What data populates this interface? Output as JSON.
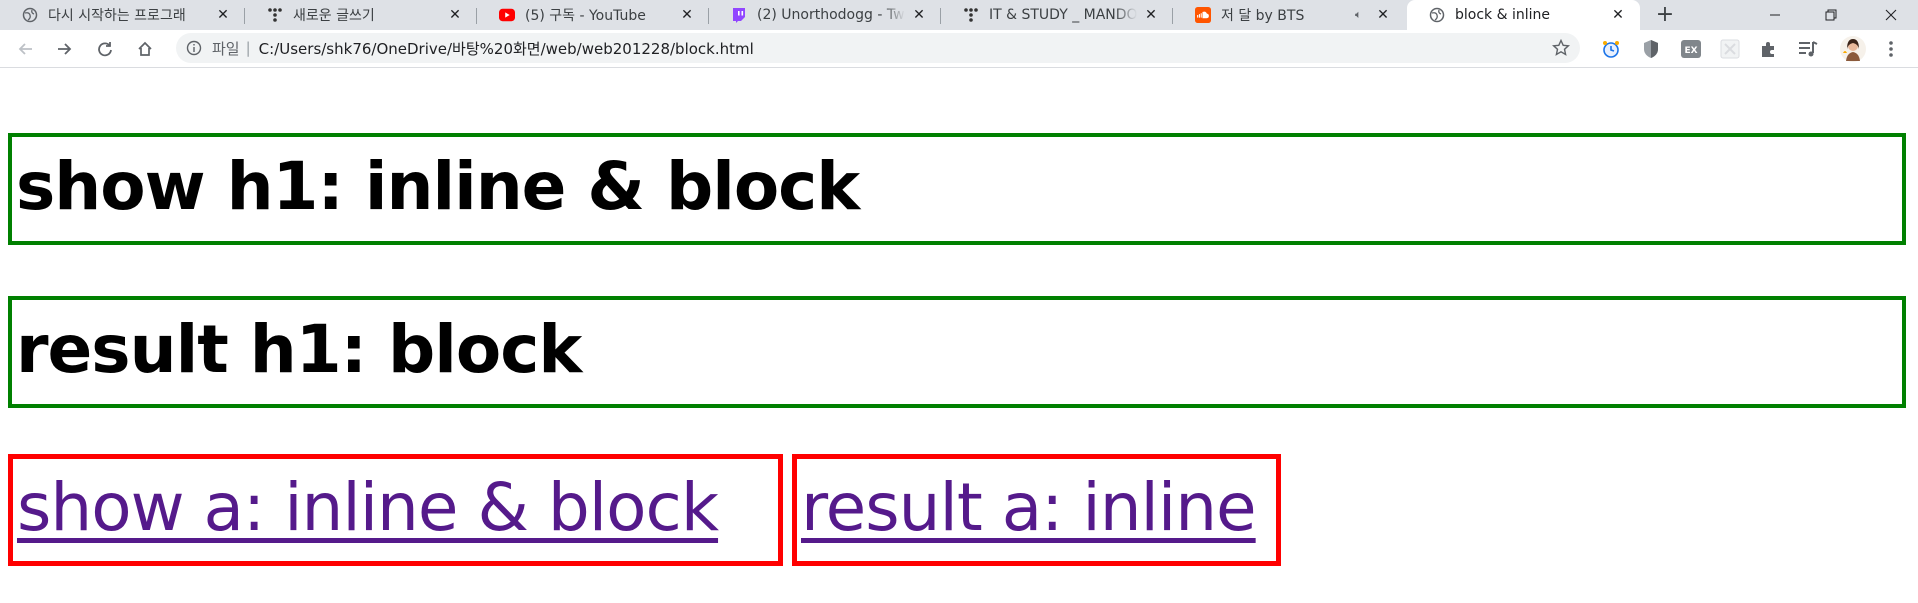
{
  "tabs": [
    {
      "title": "다시 시작하는 프로그래",
      "icon": "globe-icon",
      "active": false
    },
    {
      "title": "새로운 글쓰기",
      "icon": "tistory-icon",
      "active": false
    },
    {
      "title": "(5) 구독 - YouTube",
      "icon": "youtube-icon",
      "active": false
    },
    {
      "title": "(2) Unorthodogg - Tw",
      "icon": "twitch-icon",
      "active": false
    },
    {
      "title": "IT & STUDY _ MANDO",
      "icon": "tistory-icon",
      "active": false
    },
    {
      "title": "저 달 by BTS",
      "icon": "soundcloud-icon",
      "active": false,
      "audio": "speaker-icon"
    },
    {
      "title": "block & inline",
      "icon": "globe-icon",
      "active": true
    }
  ],
  "tab_close_glyph": "✕",
  "new_tab_glyph": "+",
  "window_controls": {
    "minimize": "—",
    "maximize": "❐",
    "close": "✕"
  },
  "address_bar": {
    "scheme_label": "파일",
    "separator": "|",
    "url": "C:/Users/shk76/OneDrive/바탕%20화면/web/web201228/block.html"
  },
  "extensions": [
    "clock-extension-icon",
    "shield-extension-icon",
    "ex-extension-icon",
    "grid-extension-icon",
    "puzzle-icon",
    "media-queue-icon",
    "profile-avatar"
  ],
  "extension_labels": {
    "ex": "EX"
  },
  "colors": {
    "h1_border": "#008000",
    "a_border": "#ff0000",
    "link": "#551a8b",
    "tabstrip_bg": "#dee1e6"
  },
  "page": {
    "h1_show": "show h1: inline & block",
    "h1_result": "result h1: block",
    "a_show": "show a: inline & block",
    "a_result": "result a: inline"
  }
}
